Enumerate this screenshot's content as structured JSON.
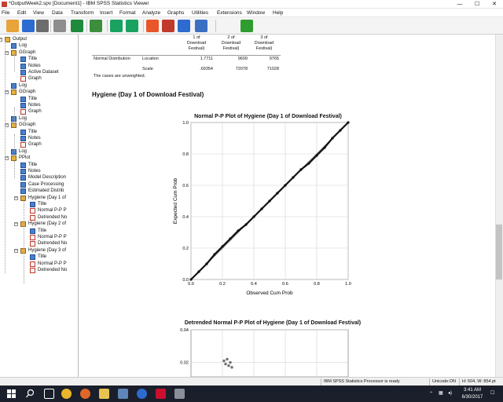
{
  "window": {
    "title": "*OutputWeek2.spv [Document1] - IBM SPSS Statistics Viewer",
    "minimize": "—",
    "maximize": "☐",
    "close": "✕"
  },
  "menu": [
    "File",
    "Edit",
    "View",
    "Data",
    "Transform",
    "Insert",
    "Format",
    "Analyze",
    "Graphs",
    "Utilities",
    "Extensions",
    "Window",
    "Help"
  ],
  "toolbar": {
    "buttons": [
      "open-file-icon",
      "save-icon",
      "print-icon",
      "print-preview-icon",
      "export-icon",
      "recall-dialog-icon",
      "undo-icon",
      "redo-icon",
      "goto-data-icon",
      "goto-case-icon",
      "goto-variable-icon",
      "variables-icon",
      "designate-window-icon"
    ]
  },
  "outline": {
    "items": [
      {
        "label": "Output",
        "level": 0,
        "icon": "book",
        "expander": "–"
      },
      {
        "label": "Log",
        "level": 1,
        "icon": "out"
      },
      {
        "label": "GGraph",
        "level": 1,
        "icon": "book",
        "expander": "–"
      },
      {
        "label": "Title",
        "level": 2,
        "icon": "out"
      },
      {
        "label": "Notes",
        "level": 2,
        "icon": "out"
      },
      {
        "label": "Active Dataset",
        "level": 2,
        "icon": "out"
      },
      {
        "label": "Graph",
        "level": 2,
        "icon": "gr"
      },
      {
        "label": "Log",
        "level": 1,
        "icon": "out"
      },
      {
        "label": "GGraph",
        "level": 1,
        "icon": "book",
        "expander": "–"
      },
      {
        "label": "Title",
        "level": 2,
        "icon": "out"
      },
      {
        "label": "Notes",
        "level": 2,
        "icon": "out"
      },
      {
        "label": "Graph",
        "level": 2,
        "icon": "gr"
      },
      {
        "label": "Log",
        "level": 1,
        "icon": "out"
      },
      {
        "label": "GGraph",
        "level": 1,
        "icon": "book",
        "expander": "–"
      },
      {
        "label": "Title",
        "level": 2,
        "icon": "out"
      },
      {
        "label": "Notes",
        "level": 2,
        "icon": "out"
      },
      {
        "label": "Graph",
        "level": 2,
        "icon": "gr"
      },
      {
        "label": "Log",
        "level": 1,
        "icon": "out"
      },
      {
        "label": "PPlot",
        "level": 1,
        "icon": "book",
        "expander": "–"
      },
      {
        "label": "Title",
        "level": 2,
        "icon": "out"
      },
      {
        "label": "Notes",
        "level": 2,
        "icon": "out"
      },
      {
        "label": "Model Description",
        "level": 2,
        "icon": "out"
      },
      {
        "label": "Case Processing",
        "level": 2,
        "icon": "out"
      },
      {
        "label": "Estimated Distrib",
        "level": 2,
        "icon": "out"
      },
      {
        "label": "Hygiene (Day 1 of",
        "level": 2,
        "icon": "book",
        "expander": "–"
      },
      {
        "label": "Title",
        "level": 3,
        "icon": "out"
      },
      {
        "label": "Normal P-P P",
        "level": 3,
        "icon": "gr"
      },
      {
        "label": "Detrended No",
        "level": 3,
        "icon": "gr"
      },
      {
        "label": "Hygiene (Day 2 of",
        "level": 2,
        "icon": "book",
        "expander": "–"
      },
      {
        "label": "Title",
        "level": 3,
        "icon": "out"
      },
      {
        "label": "Normal P-P P",
        "level": 3,
        "icon": "gr"
      },
      {
        "label": "Detrended No",
        "level": 3,
        "icon": "gr"
      },
      {
        "label": "Hygiene (Day 3 of",
        "level": 2,
        "icon": "book",
        "expander": "–"
      },
      {
        "label": "Title",
        "level": 3,
        "icon": "out"
      },
      {
        "label": "Normal P-P P",
        "level": 3,
        "icon": "gr"
      },
      {
        "label": "Detrended No",
        "level": 3,
        "icon": "gr"
      }
    ]
  },
  "table": {
    "col_headers": [
      [
        "1 of",
        "Download",
        "Festival)"
      ],
      [
        "2 of",
        "Download",
        "Festival)"
      ],
      [
        "3 of",
        "Download",
        "Festival)"
      ]
    ],
    "row_group": "Normal Distribution",
    "rows": [
      {
        "label": "Location",
        "values": [
          "1.7711",
          "9609",
          "9765"
        ]
      },
      {
        "label": "Scale",
        "values": [
          ".69354",
          "72078",
          "71028"
        ]
      }
    ],
    "footnote": "The cases are unweighted."
  },
  "section_title": "Hygiene (Day 1 of Download Festival)",
  "chart_data": [
    {
      "type": "scatter",
      "title": "Normal P-P Plot of Hygiene (Day 1 of Download Festival)",
      "xlabel": "Observed Cum Prob",
      "ylabel": "Expected Cum Prob",
      "xlim": [
        0,
        1
      ],
      "ylim": [
        0,
        1
      ],
      "xticks": [
        "0.0",
        "0.2",
        "0.4",
        "0.6",
        "0.8",
        "1.0"
      ],
      "yticks": [
        "0.0",
        "0.2",
        "0.4",
        "0.6",
        "0.8",
        "1.0"
      ],
      "grid": true,
      "reference_line": {
        "from": [
          0,
          0
        ],
        "to": [
          1,
          1
        ]
      },
      "x": [
        0.0,
        0.05,
        0.1,
        0.15,
        0.2,
        0.25,
        0.3,
        0.35,
        0.4,
        0.45,
        0.5,
        0.55,
        0.6,
        0.65,
        0.7,
        0.75,
        0.8,
        0.85,
        0.9,
        0.95,
        1.0
      ],
      "y": [
        0.0,
        0.05,
        0.1,
        0.16,
        0.21,
        0.26,
        0.31,
        0.35,
        0.4,
        0.45,
        0.5,
        0.55,
        0.6,
        0.65,
        0.7,
        0.74,
        0.79,
        0.84,
        0.9,
        0.95,
        1.0
      ]
    },
    {
      "type": "scatter",
      "title": "Detrended Normal P-P Plot of Hygiene (Day 1 of Download Festival)",
      "yticks": [
        "0.04",
        "0.02"
      ],
      "ylim": [
        0.015,
        0.04
      ],
      "grid": true,
      "x": [
        0.21,
        0.22,
        0.23,
        0.24,
        0.25,
        0.26
      ],
      "y": [
        0.021,
        0.019,
        0.022,
        0.018,
        0.02,
        0.017
      ]
    }
  ],
  "status": {
    "processor": "IBM SPSS Statistics Processor is ready",
    "unicode": "Unicode:ON",
    "dims": "H: 504, W: 854 pt"
  },
  "taskbar": {
    "time": "3:41 AM",
    "date": "6/30/2017"
  },
  "colors": {
    "taskbar": "#1a1f2b",
    "accent": "#2e6bd1",
    "line": "#111111",
    "points": "#7a7a7a"
  }
}
